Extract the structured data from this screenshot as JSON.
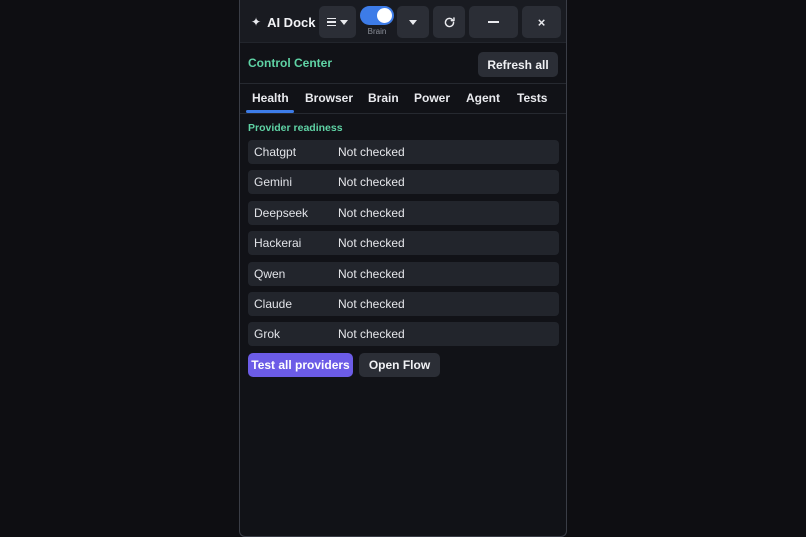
{
  "app": {
    "title": "AI Dock",
    "toggle_label": "Brain",
    "toggle_on": true
  },
  "header": {
    "title": "Control Center",
    "refresh_label": "Refresh all"
  },
  "tabs": [
    {
      "label": "Health",
      "active": true
    },
    {
      "label": "Browser",
      "active": false
    },
    {
      "label": "Brain",
      "active": false
    },
    {
      "label": "Power",
      "active": false
    },
    {
      "label": "Agent",
      "active": false
    },
    {
      "label": "Tests",
      "active": false
    }
  ],
  "health": {
    "section_title": "Provider readiness",
    "providers": [
      {
        "name": "Chatgpt",
        "status": "Not checked"
      },
      {
        "name": "Gemini",
        "status": "Not checked"
      },
      {
        "name": "Deepseek",
        "status": "Not checked"
      },
      {
        "name": "Hackerai",
        "status": "Not checked"
      },
      {
        "name": "Qwen",
        "status": "Not checked"
      },
      {
        "name": "Claude",
        "status": "Not checked"
      },
      {
        "name": "Grok",
        "status": "Not checked"
      }
    ],
    "test_all_label": "Test all providers",
    "open_flow_label": "Open Flow"
  },
  "icons": {
    "brand": "sparkle-icon",
    "menu": "hamburger-icon",
    "caret": "chevron-down-icon",
    "reload": "reload-icon",
    "minimize": "minimize-icon",
    "close": "close-icon"
  },
  "colors": {
    "accent_blue": "#3d7ce8",
    "accent_green": "#5fd3a5",
    "accent_purple": "#6c5ce7",
    "background": "#111217",
    "surface": "#22252c"
  }
}
